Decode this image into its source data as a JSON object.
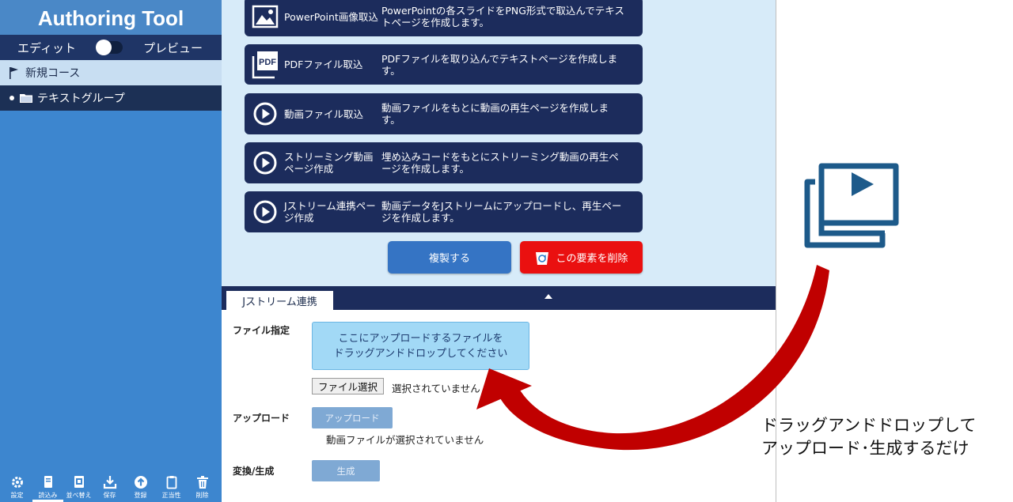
{
  "sidebar": {
    "title": "Authoring Tool",
    "mode_edit": "エディット",
    "mode_preview": "プレビュー",
    "course_label": "新規コース",
    "group_label": "テキストグループ",
    "tools": [
      {
        "icon": "gear-icon",
        "label": "設定"
      },
      {
        "icon": "book-icon",
        "label": "読込み"
      },
      {
        "icon": "reorder-icon",
        "label": "並べ替え"
      },
      {
        "icon": "download-icon",
        "label": "保存"
      },
      {
        "icon": "upload-circle-icon",
        "label": "登録"
      },
      {
        "icon": "clipboard-icon",
        "label": "正当性"
      },
      {
        "icon": "trash-icon",
        "label": "削除"
      }
    ]
  },
  "cards": [
    {
      "icon": "image-icon",
      "name": "PowerPoint画像取込",
      "desc": "PowerPointの各スライドをPNG形式で取込んでテキストページを作成します。"
    },
    {
      "icon": "pdf-icon",
      "name": "PDFファイル取込",
      "desc": "PDFファイルを取り込んでテキストページを作成します。"
    },
    {
      "icon": "play-icon",
      "name": "動画ファイル取込",
      "desc": "動画ファイルをもとに動画の再生ページを作成します。"
    },
    {
      "icon": "play-icon",
      "name": "ストリーミング動画ページ作成",
      "desc": "埋め込みコードをもとにストリーミング動画の再生ページを作成します。"
    },
    {
      "icon": "play-icon",
      "name": "Jストリーム連携ページ作成",
      "desc": "動画データをJストリームにアップロードし、再生ページを作成します。"
    }
  ],
  "actions": {
    "duplicate": "複製する",
    "delete": "この要素を削除"
  },
  "panel": {
    "tab": "Jストリーム連携",
    "file_label": "ファイル指定",
    "dropzone_line1": "ここにアップロードするファイルを",
    "dropzone_line2": "ドラッグアンドドロップしてください",
    "file_button": "ファイル選択",
    "file_status": "選択されていません",
    "upload_label": "アップロード",
    "upload_button": "アップロード",
    "upload_status": "動画ファイルが選択されていません",
    "convert_label": "変換/生成",
    "generate_button": "生成"
  },
  "annotation": {
    "line1": "ドラッグアンドドロップして",
    "line2": "アップロード･生成するだけ"
  },
  "colors": {
    "navy": "#1c2c5c",
    "sidebar": "#3d86cf",
    "delete": "#ea1010",
    "arrow": "#c00000",
    "icon": "#1d5a8a"
  }
}
